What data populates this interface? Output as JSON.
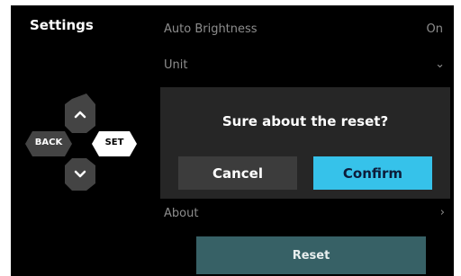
{
  "sidebar": {
    "title": "Settings"
  },
  "settings": {
    "auto_brightness": {
      "label": "Auto Brightness",
      "value": "On"
    },
    "unit": {
      "label": "Unit",
      "chevron": "chevron-down-icon"
    },
    "about": {
      "label": "About",
      "chevron": "chevron-right-icon"
    }
  },
  "dialog": {
    "title": "Sure about the reset?",
    "cancel_label": "Cancel",
    "confirm_label": "Confirm"
  },
  "reset_button": {
    "label": "Reset"
  },
  "dpad": {
    "back_label": "BACK",
    "set_label": "SET",
    "up_icon": "chevron-up-icon",
    "down_icon": "chevron-down-icon"
  },
  "colors": {
    "confirm": "#36c2ea",
    "reset": "#376166",
    "dialog_bg": "#262626",
    "cancel_bg": "#3c3c3c"
  }
}
